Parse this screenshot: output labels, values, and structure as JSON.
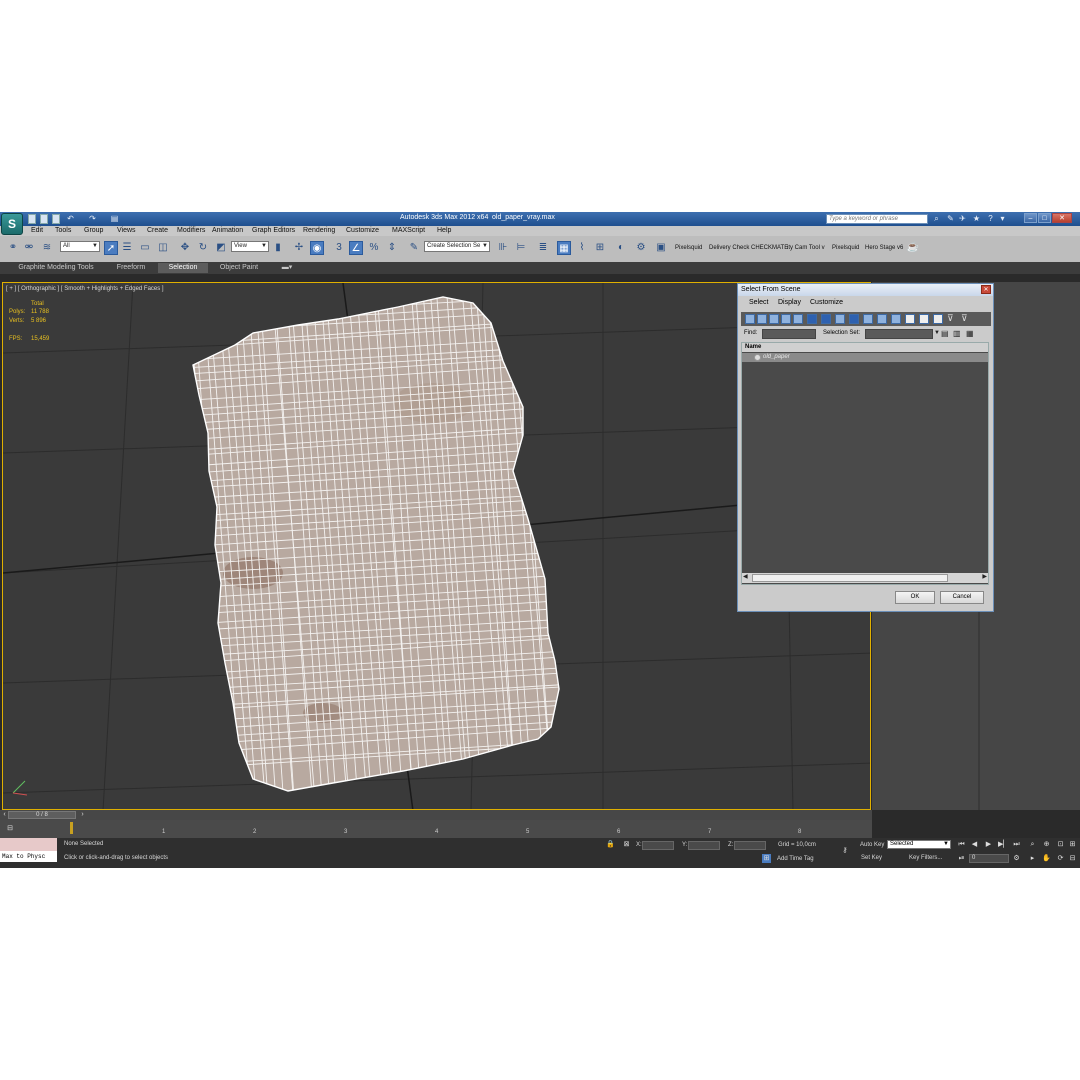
{
  "window": {
    "title": "Autodesk 3ds Max  2012 x64",
    "file": "old_paper_vray.max",
    "search_placeholder": "Type a keyword or phrase"
  },
  "menu": [
    "Edit",
    "Tools",
    "Group",
    "Views",
    "Create",
    "Modifiers",
    "Animation",
    "Graph Editors",
    "Rendering",
    "Customize",
    "MAXScript",
    "Help"
  ],
  "toolbar": {
    "selection_filter": "All",
    "reference_coord": "View",
    "named_selection": "Create Selection Se",
    "plugins": [
      "Pixelsquid",
      "Delivery Check",
      "CHECKMATE",
      "ity Cam Tool v",
      "Pixelsquid",
      "Hero Stage v6"
    ]
  },
  "ribbon": {
    "tabs": [
      "Graphite Modeling Tools",
      "Freeform",
      "Selection",
      "Object Paint"
    ],
    "selected": "Selection"
  },
  "viewport": {
    "label": "[ + ] [ Orthographic ] [ Smooth + Highlights + Edged Faces ]",
    "stats": {
      "total_label": "Total",
      "polys_label": "Polys:",
      "polys": "11 788",
      "verts_label": "Verts:",
      "verts": "5 896",
      "fps_label": "FPS:",
      "fps": "15,459"
    }
  },
  "timeline": {
    "frame": "0 / 8",
    "ticks": [
      "1",
      "2",
      "3",
      "4",
      "5",
      "6",
      "7",
      "8"
    ]
  },
  "status": {
    "maxscript": "Max to Physc",
    "selection": "None Selected",
    "prompt": "Click or click-and-drag to select objects",
    "x_label": "X:",
    "y_label": "Y:",
    "z_label": "Z:",
    "grid": "Grid = 10,0cm",
    "add_time_tag": "Add Time Tag",
    "auto_key": "Auto Key",
    "set_key": "Set Key",
    "key_mode": "Selected",
    "key_filters": "Key Filters...",
    "current_frame": "0"
  },
  "dialog": {
    "title": "Select From Scene",
    "menu": [
      "Select",
      "Display",
      "Customize"
    ],
    "find_label": "Find:",
    "selection_set_label": "Selection Set:",
    "column": "Name",
    "items": [
      "old_paper"
    ],
    "ok": "OK",
    "cancel": "Cancel"
  }
}
